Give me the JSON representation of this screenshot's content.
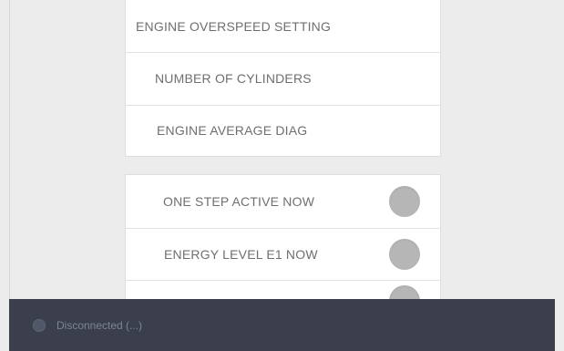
{
  "settings": {
    "items": [
      {
        "label": "ENGINE OVERSPEED SETTING"
      },
      {
        "label": "NUMBER OF CYLINDERS"
      },
      {
        "label": "ENGINE AVERAGE DIAG"
      }
    ]
  },
  "diagnostics": {
    "items": [
      {
        "label": "ONE STEP ACTIVE NOW",
        "indicator_color": "#b6b6b6"
      },
      {
        "label": "ENERGY LEVEL E1 NOW",
        "indicator_color": "#b6b6b6"
      },
      {
        "label": "",
        "indicator_color": "#b6b6b6"
      }
    ]
  },
  "status": {
    "text": "Disconnected (...)",
    "icon": "disconnected-icon"
  }
}
